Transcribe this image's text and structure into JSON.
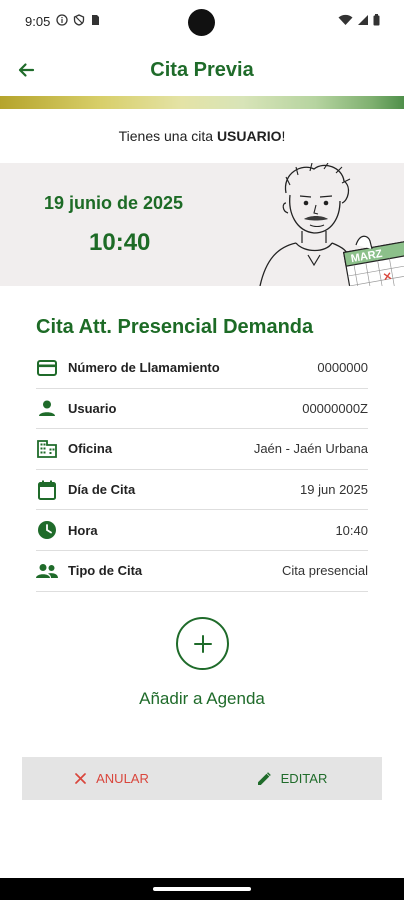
{
  "status": {
    "time": "9:05"
  },
  "header": {
    "title": "Cita Previa"
  },
  "greeting": {
    "prefix": "Tienes una cita ",
    "user": "USUARIO",
    "suffix": "!"
  },
  "banner": {
    "date": "19 junio de 2025",
    "time": "10:40",
    "calendar_text": "MARZ"
  },
  "appointment": {
    "title": "Cita Att. Presencial Demanda",
    "rows": [
      {
        "icon": "card-icon",
        "label": "Número de Llamamiento",
        "value": "0000000"
      },
      {
        "icon": "person-icon",
        "label": "Usuario",
        "value": "00000000Z"
      },
      {
        "icon": "building-icon",
        "label": "Oficina",
        "value": "Jaén - Jaén Urbana"
      },
      {
        "icon": "calendar-icon",
        "label": "Día de Cita",
        "value": "19 jun 2025"
      },
      {
        "icon": "clock-icon",
        "label": "Hora",
        "value": "10:40"
      },
      {
        "icon": "people-icon",
        "label": "Tipo de Cita",
        "value": "Cita presencial"
      }
    ]
  },
  "agenda": {
    "label": "Añadir a Agenda"
  },
  "actions": {
    "cancel": "ANULAR",
    "edit": "EDITAR"
  },
  "colors": {
    "primary": "#1f6b2a",
    "danger": "#d9463c",
    "banner_bg": "#f1eeee"
  }
}
